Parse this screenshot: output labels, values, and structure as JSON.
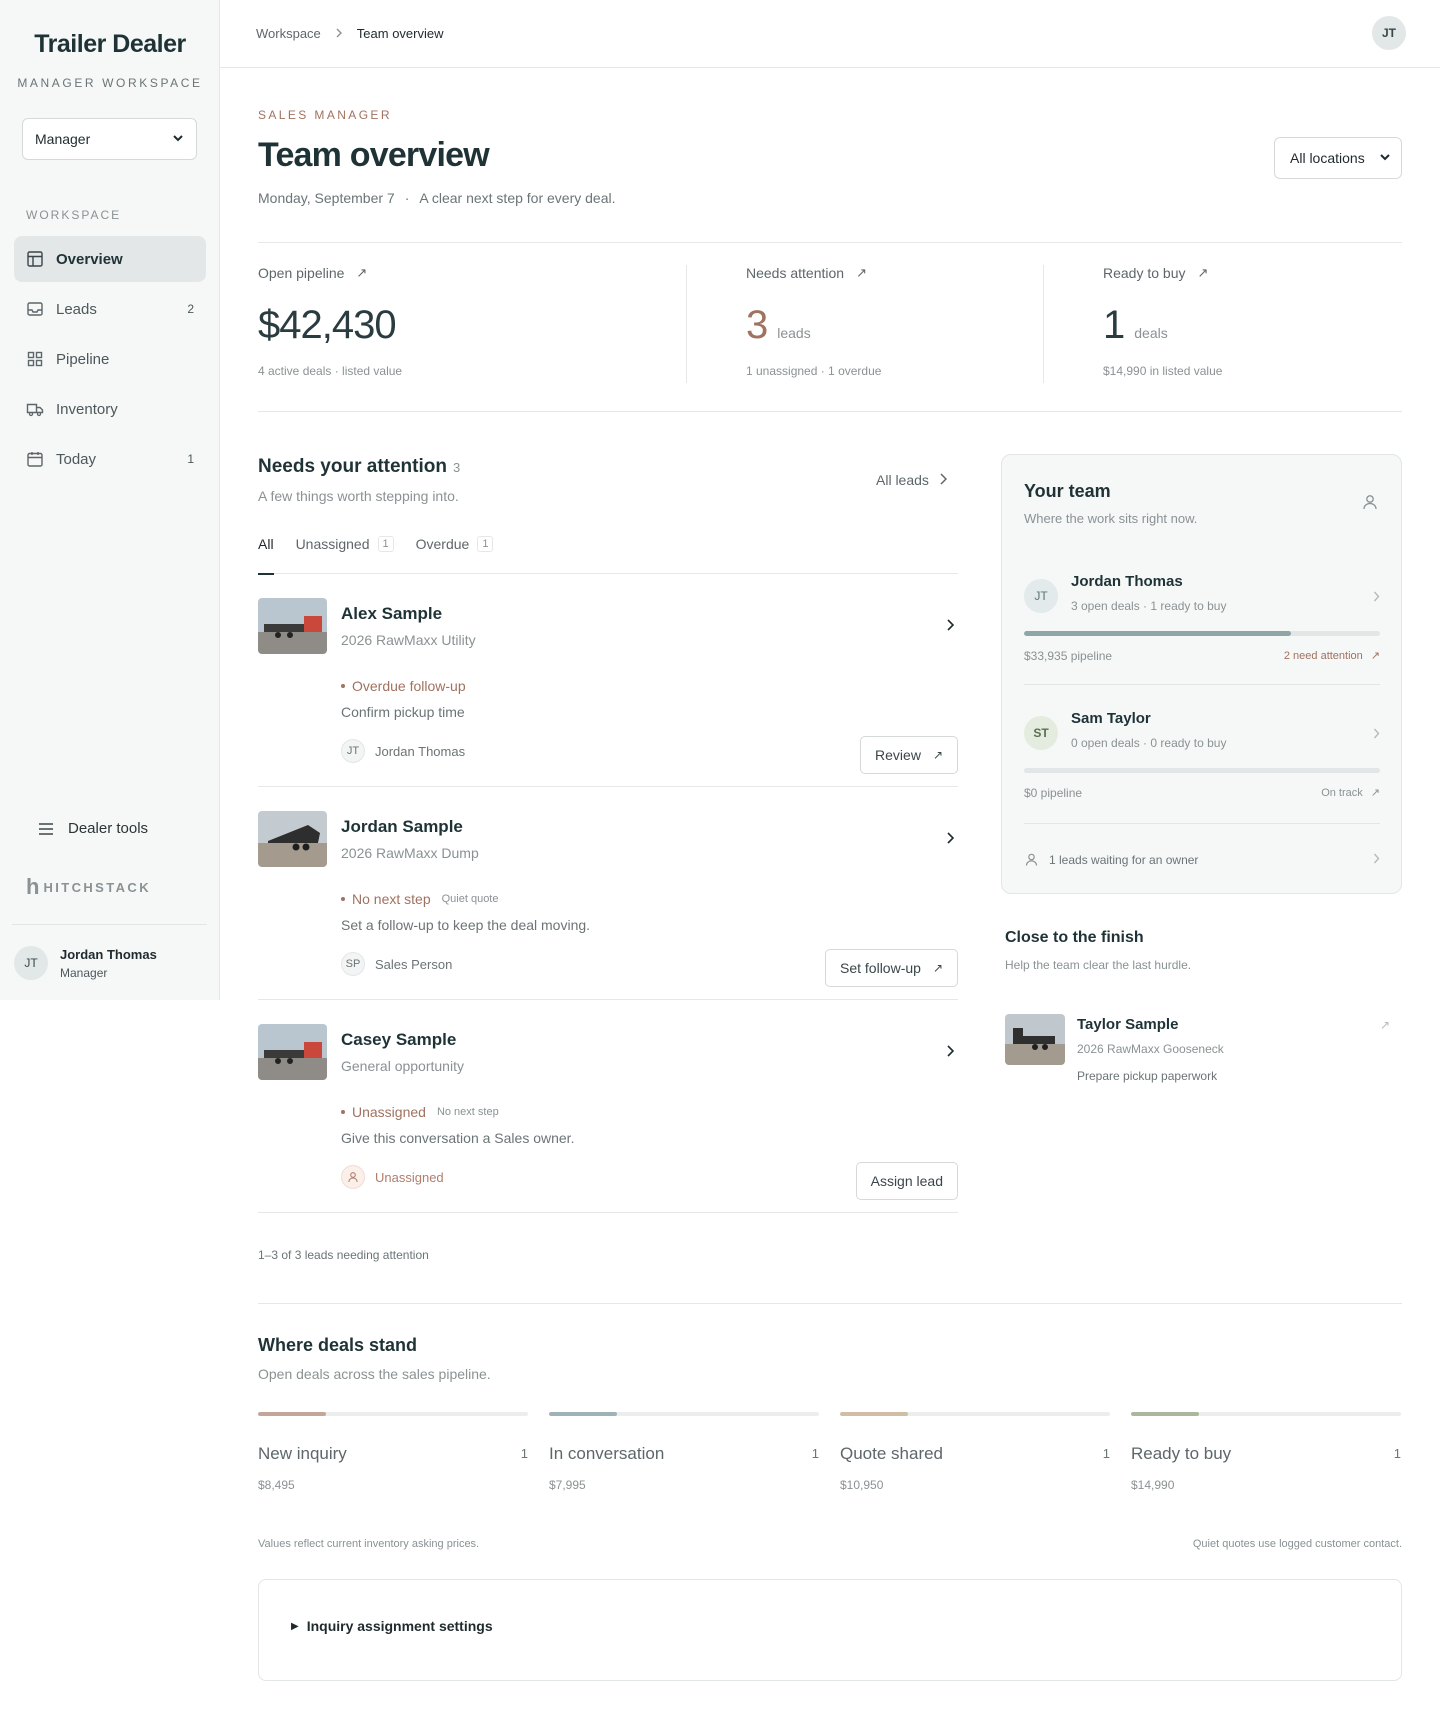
{
  "brand": {
    "title": "Trailer Dealer",
    "subtitle": "MANAGER WORKSPACE"
  },
  "role_select": {
    "value": "Manager"
  },
  "sidebar": {
    "section": "WORKSPACE",
    "items": [
      {
        "label": "Overview",
        "count": "",
        "icon": "layout-icon",
        "active": true
      },
      {
        "label": "Leads",
        "count": "2",
        "icon": "inbox-icon"
      },
      {
        "label": "Pipeline",
        "count": "",
        "icon": "grid-icon"
      },
      {
        "label": "Inventory",
        "count": "",
        "icon": "truck-icon"
      },
      {
        "label": "Today",
        "count": "1",
        "icon": "calendar-icon"
      }
    ],
    "dealer_tools": "Dealer tools",
    "hitchstack": "HITCHSTACK",
    "user": {
      "initials": "JT",
      "name": "Jordan Thomas",
      "role": "Manager"
    }
  },
  "topbar": {
    "crumbs": [
      "Workspace",
      "Team overview"
    ],
    "avatar": "JT"
  },
  "header": {
    "eyebrow": "SALES MANAGER",
    "title": "Team overview",
    "date": "Monday, September 7",
    "dot": "·",
    "tagline": "A clear next step for every deal.",
    "location": "All locations"
  },
  "stats": {
    "pipeline": {
      "label": "Open pipeline",
      "value": "$42,430",
      "unit": "",
      "foot": "4 active deals · listed value"
    },
    "attention": {
      "label": "Needs attention",
      "value": "3",
      "unit": "leads",
      "foot": "1 unassigned · 1 overdue"
    },
    "ready": {
      "label": "Ready to buy",
      "value": "1",
      "unit": "deals",
      "foot": "$14,990 in listed value"
    }
  },
  "attention": {
    "title": "Needs your attention",
    "count": "3",
    "subtitle": "A few things worth stepping into.",
    "all_leads": "All leads",
    "tabs": [
      {
        "label": "All",
        "badge": ""
      },
      {
        "label": "Unassigned",
        "badge": "1"
      },
      {
        "label": "Overdue",
        "badge": "1"
      }
    ],
    "leads": [
      {
        "name": "Alex Sample",
        "model": "2026 RawMaxx Utility",
        "status": "Overdue follow-up",
        "tag": "",
        "note": "Confirm pickup time",
        "owner_initials": "JT",
        "owner": "Jordan Thomas",
        "action": "Review"
      },
      {
        "name": "Jordan Sample",
        "model": "2026 RawMaxx Dump",
        "status": "No next step",
        "tag": "Quiet quote",
        "note": "Set a follow-up to keep the deal moving.",
        "owner_initials": "SP",
        "owner": "Sales Person",
        "action": "Set follow-up"
      },
      {
        "name": "Casey Sample",
        "model": "General opportunity",
        "status": "Unassigned",
        "tag": "No next step",
        "note": "Give this conversation a Sales owner.",
        "owner_initials": "",
        "owner": "Unassigned",
        "action": "Assign lead"
      }
    ],
    "pager": "1–3 of 3 leads needing attention"
  },
  "team": {
    "title": "Your team",
    "subtitle": "Where the work sits right now.",
    "members": [
      {
        "initials": "JT",
        "name": "Jordan Thomas",
        "summary": "3 open deals · 1 ready to buy",
        "progress": 0.75,
        "pipeline": "$33,935 pipeline",
        "flag": "2 need attention"
      },
      {
        "initials": "ST",
        "name": "Sam Taylor",
        "summary": "0 open deals · 0 ready to buy",
        "progress": 0,
        "pipeline": "$0 pipeline",
        "flag": "On track"
      }
    ],
    "waiting": "1 leads waiting for an owner"
  },
  "finish": {
    "title": "Close to the finish",
    "subtitle": "Help the team clear the last hurdle.",
    "item": {
      "name": "Taylor Sample",
      "model": "2026 RawMaxx Gooseneck",
      "task": "Prepare pickup paperwork"
    }
  },
  "deals": {
    "title": "Where deals stand",
    "subtitle": "Open deals across the sales pipeline.",
    "stages": [
      {
        "label": "New inquiry",
        "count": "1",
        "value": "$8,495",
        "share": 0.25,
        "color": "#c4a59a"
      },
      {
        "label": "In conversation",
        "count": "1",
        "value": "$7,995",
        "share": 0.25,
        "color": "#9fb2b8"
      },
      {
        "label": "Quote shared",
        "count": "1",
        "value": "$10,950",
        "share": 0.25,
        "color": "#d1bda4"
      },
      {
        "label": "Ready to buy",
        "count": "1",
        "value": "$14,990",
        "share": 0.25,
        "color": "#a9b89c"
      }
    ],
    "note_left": "Values reflect current inventory asking prices.",
    "note_right": "Quiet quotes use logged customer contact.",
    "settings": "Inquiry assignment settings"
  },
  "colors": {
    "accent": "#1f3337",
    "warm": "#a07260",
    "muted": "#8a9294"
  }
}
